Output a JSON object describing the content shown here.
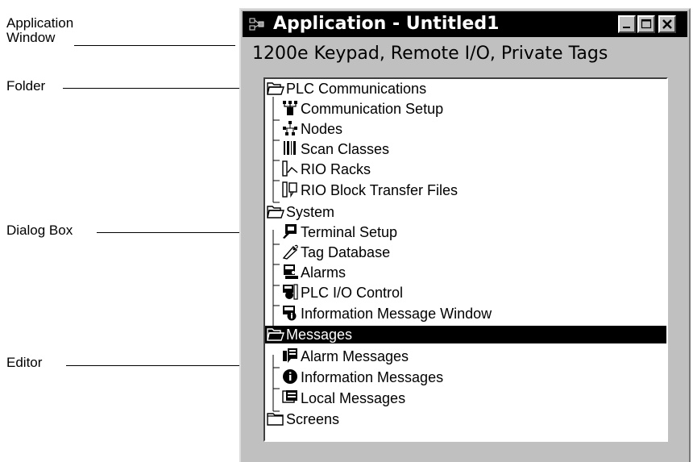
{
  "callouts": {
    "application_window": "Application\nWindow",
    "folder": "Folder",
    "dialog_box": "Dialog Box",
    "editor": "Editor"
  },
  "window": {
    "title": "Application - Untitled1",
    "subtitle": "1200e Keypad, Remote I/O, Private Tags",
    "buttons": [
      "minimize",
      "maximize",
      "close"
    ]
  },
  "tree": {
    "folders": [
      {
        "label": "PLC Communications",
        "icon": "open-folder-icon",
        "selected": false,
        "children": [
          {
            "label": "Communication Setup",
            "icon": "network-setup-icon"
          },
          {
            "label": "Nodes",
            "icon": "nodes-icon"
          },
          {
            "label": "Scan Classes",
            "icon": "barcode-icon"
          },
          {
            "label": "RIO Racks",
            "icon": "rack-icon"
          },
          {
            "label": "RIO Block Transfer Files",
            "icon": "block-transfer-icon"
          }
        ]
      },
      {
        "label": "System",
        "icon": "open-folder-icon",
        "selected": false,
        "children": [
          {
            "label": "Terminal Setup",
            "icon": "terminal-icon"
          },
          {
            "label": "Tag Database",
            "icon": "tag-database-icon"
          },
          {
            "label": "Alarms",
            "icon": "alarm-icon"
          },
          {
            "label": "PLC I/O Control",
            "icon": "io-control-icon"
          },
          {
            "label": "Information Message Window",
            "icon": "info-window-icon"
          }
        ]
      },
      {
        "label": "Messages",
        "icon": "open-folder-icon",
        "selected": true,
        "children": [
          {
            "label": "Alarm Messages",
            "icon": "alarm-message-icon"
          },
          {
            "label": "Information Messages",
            "icon": "info-message-icon"
          },
          {
            "label": "Local Messages",
            "icon": "local-message-icon"
          }
        ]
      },
      {
        "label": "Screens",
        "icon": "closed-folder-icon",
        "selected": false,
        "children": []
      }
    ]
  }
}
